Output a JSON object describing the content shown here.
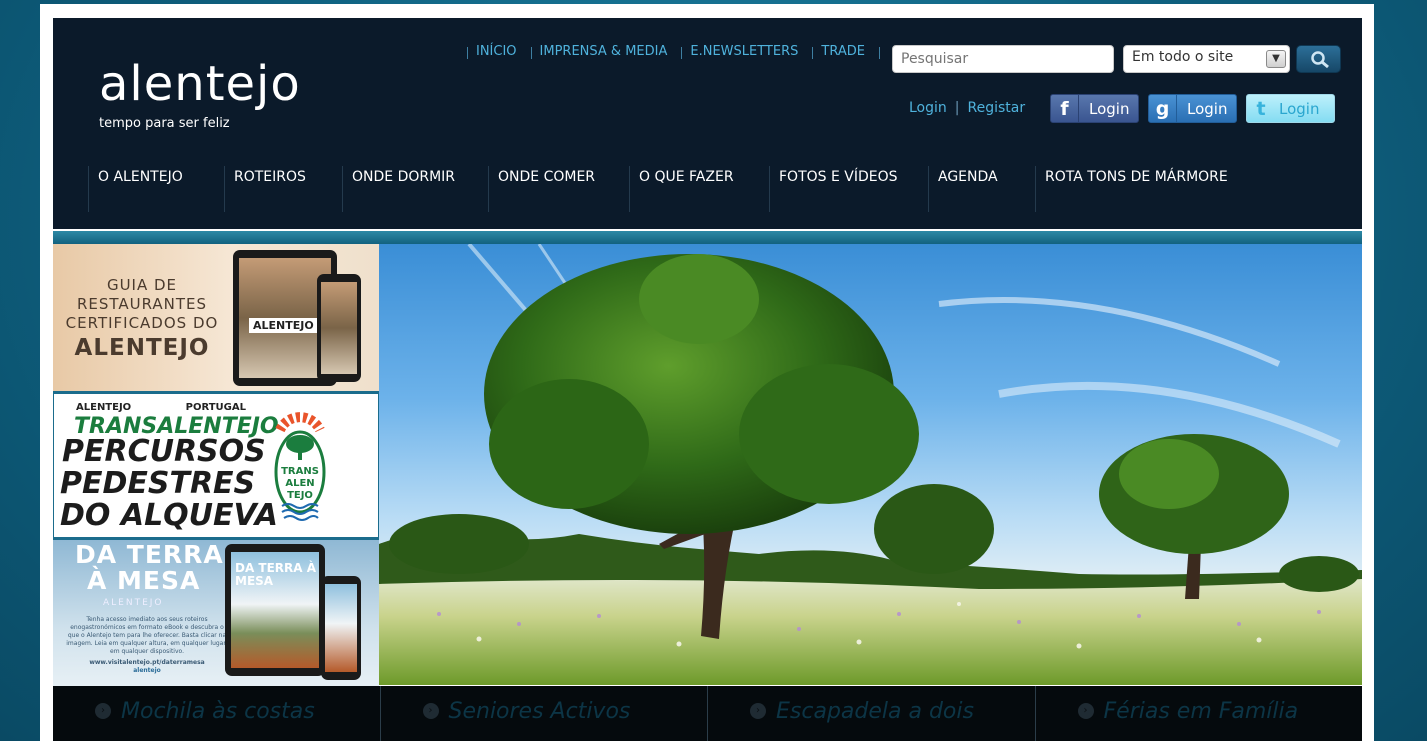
{
  "logo": {
    "name": "alentejo",
    "tagline": "tempo para ser feliz"
  },
  "top_links": [
    "INÍCIO",
    "IMPRENSA & MEDIA",
    "E.NEWSLETTERS",
    "TRADE"
  ],
  "search": {
    "placeholder": "Pesquisar",
    "scope": "Em todo o site"
  },
  "auth": {
    "login": "Login",
    "register": "Registar"
  },
  "social": {
    "facebook_label": "Login",
    "google_label": "Login",
    "twitter_label": "Login"
  },
  "nav": [
    "O ALENTEJO",
    "ROTEIROS",
    "ONDE DORMIR",
    "ONDE COMER",
    "O QUE FAZER",
    "FOTOS E VÍDEOS",
    "AGENDA",
    "ROTA TONS DE MÁRMORE"
  ],
  "promos": {
    "restaurants": {
      "line1": "GUIA DE",
      "line2": "RESTAURANTES",
      "line3": "CERTIFICADOS DO",
      "line4": "ALENTEJO",
      "device_text": "ALENTEJO"
    },
    "transalentejo": {
      "top_left": "ALENTEJO",
      "top_right": "PORTUGAL",
      "title": "TRANSALENTEJO",
      "line1": "PERCURSOS",
      "line2": "PEDESTRES",
      "line3": "DO ALQUEVA",
      "badge": [
        "TRANS",
        "ALEN",
        "TEJO"
      ]
    },
    "terra_mesa": {
      "title1": "DA TERRA",
      "title2": "À MESA",
      "subtitle": "ALENTEJO",
      "device_title": "DA TERRA À MESA",
      "body": "Tenha acesso imediato aos seus roteiros enogastronómicos em formato eBook e descubra o que o Alentejo tem para lhe oferecer. Basta clicar na imagem. Leia em qualquer altura, em qualquer lugar, em qualquer dispositivo.",
      "url": "www.visitalentejo.pt/daterramesa",
      "brand": "alentejo"
    }
  },
  "tabs": [
    "Mochila às costas",
    "Seniores Activos",
    "Escapadela a dois",
    "Férias em Família"
  ],
  "colors": {
    "header_bg": "#0b1a2a",
    "link": "#4fb2dc",
    "page_bg": "#0e5f7e"
  }
}
